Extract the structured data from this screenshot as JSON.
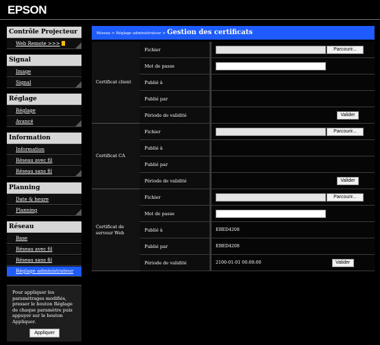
{
  "brand": "EPSON",
  "sidebar": {
    "sections": [
      {
        "title": "Contrôle Projecteur",
        "items": [
          {
            "label": "Web Remote >>>"
          }
        ]
      },
      {
        "title": "Signal",
        "items": [
          {
            "label": "Image"
          },
          {
            "label": "Signal"
          }
        ]
      },
      {
        "title": "Réglage",
        "items": [
          {
            "label": "Réglage"
          },
          {
            "label": "Avancé"
          }
        ]
      },
      {
        "title": "Information",
        "items": [
          {
            "label": "Information"
          },
          {
            "label": "Réseau avec fil"
          },
          {
            "label": "Réseau sans fil"
          }
        ]
      },
      {
        "title": "Planning",
        "items": [
          {
            "label": "Date & heure"
          },
          {
            "label": "Planning"
          }
        ]
      },
      {
        "title": "Réseau",
        "items": [
          {
            "label": "Base"
          },
          {
            "label": "Réseau avec fil"
          },
          {
            "label": "Réseau sans fil"
          },
          {
            "label": "Réglage administrateur"
          }
        ]
      }
    ],
    "info_text": "Pour appliquer les paramétrages modifiés, presser le bouton Réglage de chaque paramètre puis appuyer sur le bouton Appliquer.",
    "apply_label": "Appliquer"
  },
  "breadcrumb": {
    "path": "Réseau > Réglage administrateur >",
    "title": "Gestion des certificats"
  },
  "labels": {
    "file": "Fichier",
    "password": "Mot de passe",
    "issued_to": "Publié à",
    "issued_by": "Publié par",
    "validity": "Période de validité",
    "browse": "Parcourir...",
    "validate": "Valider"
  },
  "certs": {
    "client": {
      "name": "Certificat client",
      "issued_to": "",
      "issued_by": "",
      "validity": ""
    },
    "ca": {
      "name": "Certificat CA",
      "issued_to": "",
      "issued_by": "",
      "validity": ""
    },
    "web": {
      "name": "Certificat de serveur Web",
      "issued_to": "EBED4208",
      "issued_by": "EBED4208",
      "validity": "2100-01-01 00:00:00"
    }
  }
}
